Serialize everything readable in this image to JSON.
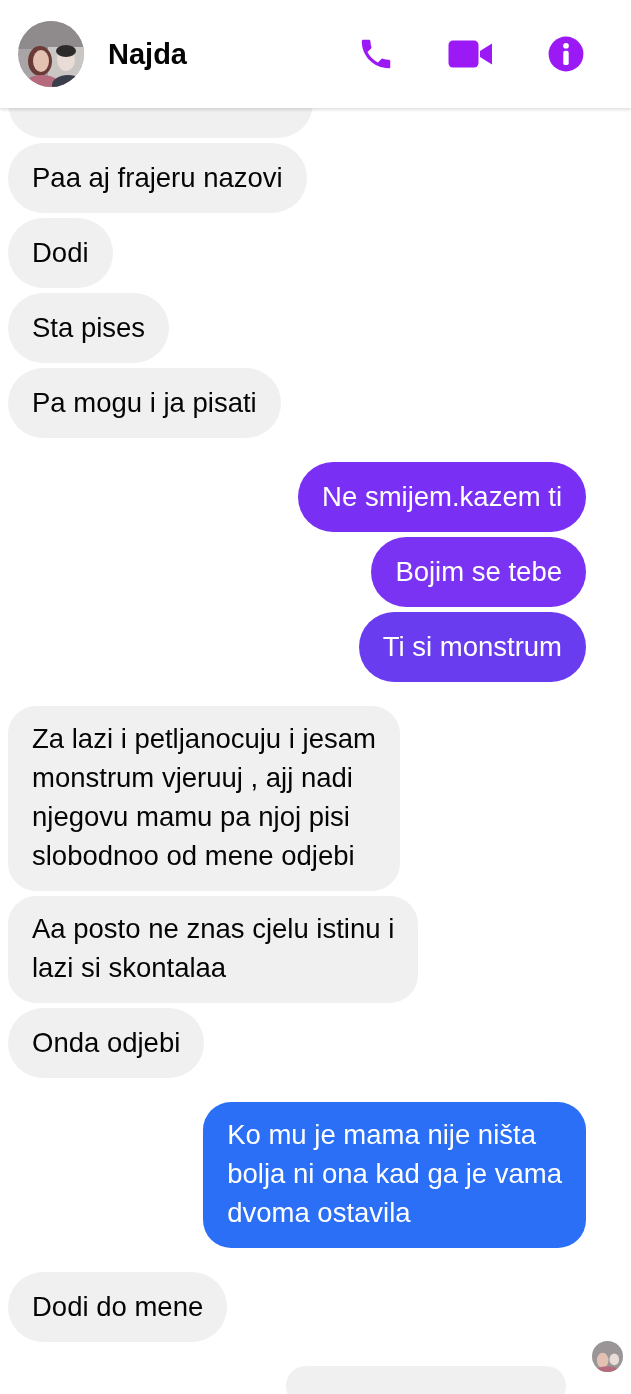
{
  "header": {
    "name": "Najda"
  },
  "messages": [
    {
      "kind": "partial",
      "color": "#f0f0f0"
    },
    {
      "kind": "received",
      "color": "#f0f0f0",
      "lines": [
        "Paa aj frajeru nazovi"
      ]
    },
    {
      "kind": "received",
      "color": "#f0f0f0",
      "lines": [
        "Dodi"
      ]
    },
    {
      "kind": "received",
      "color": "#f0f0f0",
      "lines": [
        "Sta pises"
      ]
    },
    {
      "kind": "received",
      "color": "#f0f0f0",
      "lines": [
        "Pa mogu i ja pisati"
      ]
    },
    {
      "kind": "sent",
      "color": "#7a2ff5",
      "lines": [
        "Ne smijem.kazem ti"
      ]
    },
    {
      "kind": "sent",
      "color": "#7a33f2",
      "lines": [
        "Bojim se tebe"
      ]
    },
    {
      "kind": "sent",
      "color": "#6a3cf0",
      "lines": [
        "Ti si monstrum"
      ]
    },
    {
      "kind": "received",
      "color": "#f0f0f0",
      "lines": [
        "Za lazi i petljanocuju i jesam",
        "monstrum vjeruuj , ajj nadi",
        "njegovu mamu pa njoj pisi",
        "slobodnoo od mene odjebi"
      ]
    },
    {
      "kind": "received",
      "color": "#f0f0f0",
      "lines": [
        "Aa posto ne znas cjelu istinu i",
        "lazi si skontalaa"
      ]
    },
    {
      "kind": "received",
      "color": "#f0f0f0",
      "lines": [
        "Onda odjebi"
      ]
    },
    {
      "kind": "sent",
      "color": "#2a6ff5",
      "lines": [
        "Ko mu je mama nije ništa",
        "bolja ni ona kad ga je vama",
        "dvoma ostavila"
      ]
    },
    {
      "kind": "received",
      "color": "#f0f0f0",
      "lines": [
        "Dodi do mene"
      ],
      "seen": true
    },
    {
      "kind": "partial-sent",
      "color": "#f0f0f0"
    }
  ]
}
